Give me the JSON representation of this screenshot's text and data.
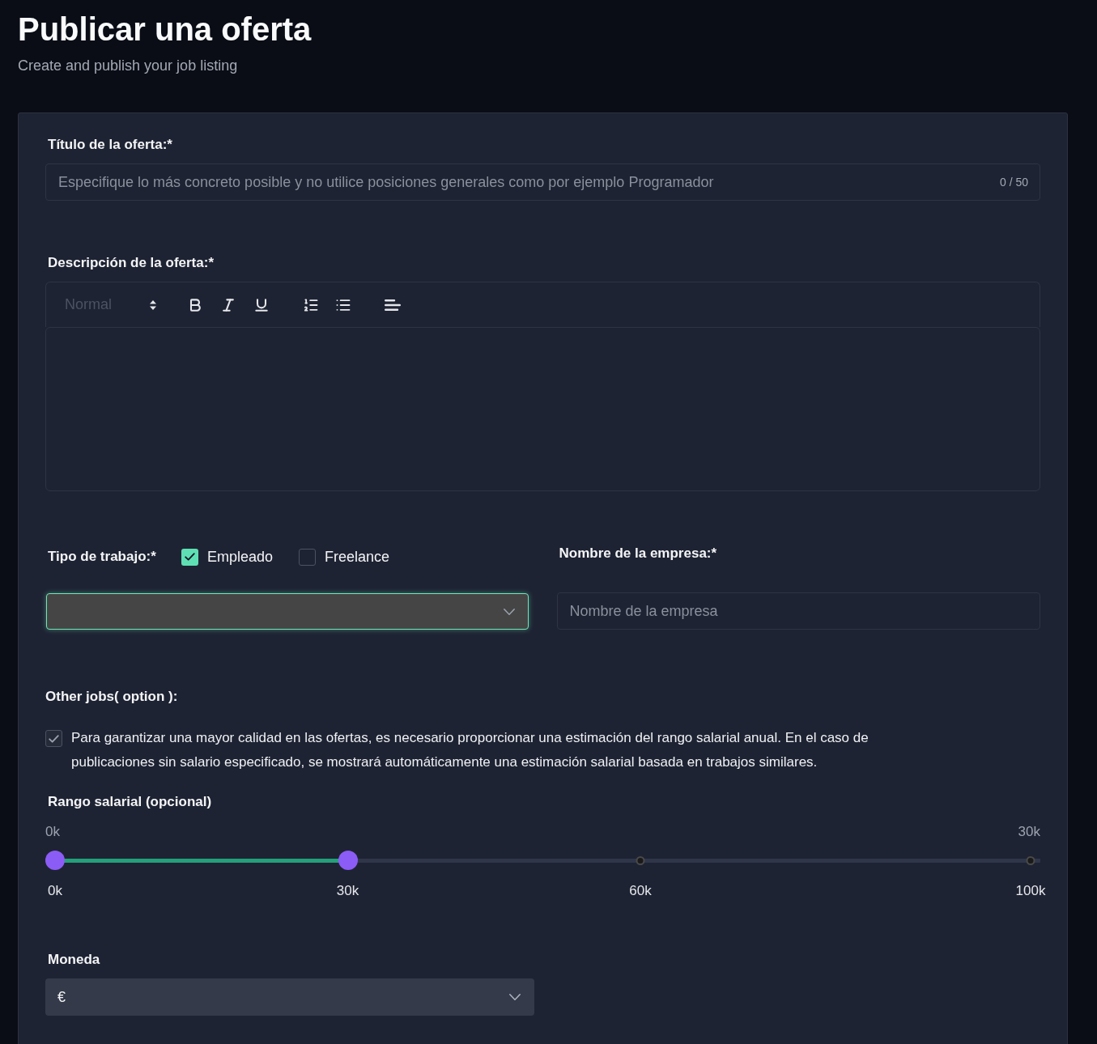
{
  "header": {
    "title": "Publicar una oferta",
    "subtitle": "Create and publish your job listing"
  },
  "title_field": {
    "label": "Título de la oferta:*",
    "placeholder": "Especifique lo más concreto posible y no utilice posiciones generales como por ejemplo Programador",
    "counter": "0 / 50"
  },
  "description": {
    "label": "Descripción de la oferta:*",
    "format": "Normal"
  },
  "job_type": {
    "label": "Tipo de trabajo:*",
    "options": [
      {
        "label": "Empleado",
        "checked": true
      },
      {
        "label": "Freelance",
        "checked": false
      }
    ],
    "select": {
      "focused": true
    }
  },
  "company": {
    "label": "Nombre de la empresa:*",
    "placeholder": "Nombre de la empresa"
  },
  "other_jobs": {
    "label": "Other jobs( option ):"
  },
  "salary_notice": {
    "checked": true,
    "disabled": true,
    "text": "Para garantizar una mayor calidad en las ofertas, es necesario proporcionar una estimación del rango salarial anual. En el caso de publicaciones sin salario especificado, se mostrará automáticamente una estimación salarial basada en trabajos similares."
  },
  "salary": {
    "label": "Rango salarial (opcional)",
    "reading_low": "0k",
    "reading_high": "30k",
    "thumbs": [
      {
        "level": 0
      },
      {
        "level": 0.3
      }
    ],
    "marks": [
      {
        "label": "0k",
        "level": 0
      },
      {
        "label": "30k",
        "level": 0.3
      },
      {
        "label": "60k",
        "level": 0.6
      },
      {
        "label": "100k",
        "level": 1
      }
    ]
  },
  "currency": {
    "label": "Moneda",
    "value": "€"
  }
}
